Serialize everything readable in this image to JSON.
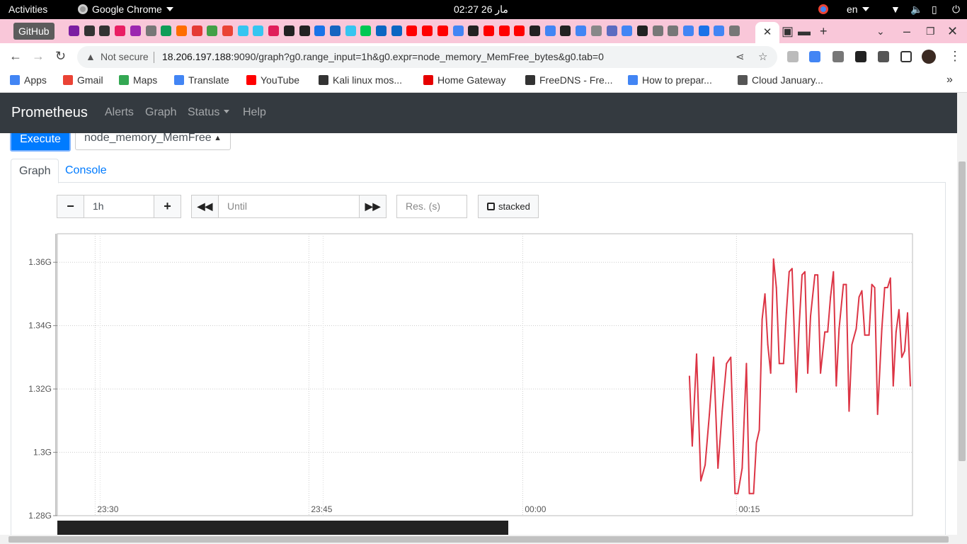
{
  "system_bar": {
    "activities": "Activities",
    "app_name": "Google Chrome",
    "clock": "02:27  26 مار",
    "lang": "en"
  },
  "browser": {
    "pinned_tab": "GitHub",
    "url_warning": "Not secure",
    "url_host": "18.206.197.188",
    "url_rest": ":9090/graph?g0.range_input=1h&g0.expr=node_memory_MemFree_bytes&g0.tab=0"
  },
  "bookmarks": [
    {
      "label": "Apps",
      "icon": "apps-grid-icon",
      "color": "#4285f4"
    },
    {
      "label": "Gmail",
      "icon": "gmail-icon",
      "color": "#ea4335"
    },
    {
      "label": "Maps",
      "icon": "maps-pin-icon",
      "color": "#34a853"
    },
    {
      "label": "Translate",
      "icon": "translate-icon",
      "color": "#4285f4"
    },
    {
      "label": "YouTube",
      "icon": "youtube-icon",
      "color": "#ff0000"
    },
    {
      "label": "Kali linux mos...",
      "icon": "kali-icon",
      "color": "#333333"
    },
    {
      "label": "Home Gateway",
      "icon": "vodafone-icon",
      "color": "#e60000"
    },
    {
      "label": "FreeDNS - Fre...",
      "icon": "globe-icon",
      "color": "#333333"
    },
    {
      "label": "How to prepar...",
      "icon": "docs-icon",
      "color": "#4285f4"
    },
    {
      "label": "Cloud January...",
      "icon": "qr-icon",
      "color": "#555555"
    }
  ],
  "prometheus": {
    "brand": "Prometheus",
    "nav": [
      "Alerts",
      "Graph",
      "Status",
      "Help"
    ],
    "execute": "Execute",
    "expression": "node_memory_MemFree",
    "tabs": [
      "Graph",
      "Console"
    ],
    "range": "1h",
    "until_placeholder": "Until",
    "res_placeholder": "Res. (s)",
    "stacked": "stacked",
    "minus": "−",
    "plus": "+"
  },
  "chart_data": {
    "type": "line",
    "metric": "node_memory_MemFree_bytes",
    "color": "#dc3545",
    "grid": true,
    "y_ticks": [
      "1.28G",
      "1.3G",
      "1.32G",
      "1.34G",
      "1.36G"
    ],
    "ylim": [
      1.28,
      1.369
    ],
    "x_ticks": [
      "23:30",
      "23:45",
      "00:00",
      "00:15"
    ],
    "x_tick_minutes": [
      -30,
      -15,
      0,
      15
    ],
    "xlim_minutes": [
      -32.65,
      27.35
    ],
    "x_minutes": [
      11.7,
      11.9,
      12.2,
      12.5,
      12.8,
      13.1,
      13.4,
      13.7,
      14.0,
      14.3,
      14.6,
      14.9,
      15.1,
      15.4,
      15.7,
      15.9,
      16.2,
      16.4,
      16.6,
      16.8,
      17.0,
      17.2,
      17.4,
      17.6,
      17.8,
      18.0,
      18.3,
      18.5,
      18.7,
      18.9,
      19.2,
      19.4,
      19.6,
      19.8,
      20.0,
      20.2,
      20.5,
      20.7,
      20.9,
      21.2,
      21.4,
      21.6,
      21.8,
      22.0,
      22.2,
      22.5,
      22.7,
      22.9,
      23.1,
      23.4,
      23.6,
      23.8,
      24.0,
      24.3,
      24.5,
      24.7,
      24.9,
      25.2,
      25.4,
      25.6,
      25.8,
      26.0,
      26.2,
      26.4,
      26.6,
      26.8,
      27.0,
      27.2
    ],
    "y_values": [
      1.324,
      1.302,
      1.331,
      1.291,
      1.296,
      1.312,
      1.33,
      1.295,
      1.313,
      1.328,
      1.33,
      1.287,
      1.287,
      1.295,
      1.328,
      1.287,
      1.287,
      1.303,
      1.307,
      1.342,
      1.35,
      1.334,
      1.325,
      1.361,
      1.352,
      1.328,
      1.328,
      1.344,
      1.357,
      1.358,
      1.319,
      1.34,
      1.356,
      1.357,
      1.325,
      1.343,
      1.356,
      1.356,
      1.325,
      1.338,
      1.338,
      1.349,
      1.357,
      1.321,
      1.339,
      1.353,
      1.353,
      1.313,
      1.334,
      1.339,
      1.349,
      1.351,
      1.337,
      1.337,
      1.353,
      1.352,
      1.312,
      1.339,
      1.352,
      1.352,
      1.355,
      1.321,
      1.338,
      1.345,
      1.33,
      1.332,
      1.344,
      1.321
    ]
  },
  "colors": {
    "nav_bg": "#343a40",
    "primary": "#007bff",
    "tab_strip": "#f9c7d9",
    "series": "#dc3545"
  }
}
